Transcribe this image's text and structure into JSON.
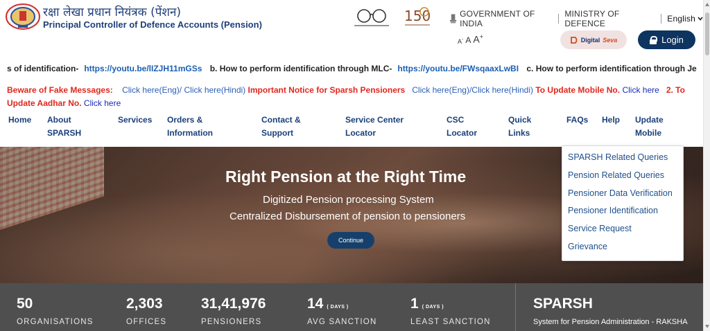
{
  "header": {
    "org_name_hi": "रक्षा लेखा प्रधान नियंत्रक (पेंशन)",
    "org_name_en": "Principal Controller of Defence Accounts (Pension)",
    "government": "GOVERNMENT OF INDIA",
    "ministry": "MINISTRY OF DEFENCE",
    "language": "English",
    "font_small": "A",
    "font_medium": "A",
    "font_large": "A",
    "font_large_suffix": "+",
    "digiseva_prefix": "Digital",
    "digiseva_suffix": "Seva",
    "login_label": "Login"
  },
  "marquee": {
    "item1_text": "s of identification-",
    "item1_link": "https://youtu.be/lIZJH11mGSs",
    "item2_text": "b. How to perform identification through MLC-",
    "item2_link": "https://youtu.be/FWsqaaxLwBI",
    "item3_text": "c. How to perform identification through Je"
  },
  "notice": {
    "fake_label": "Beware of Fake Messages:",
    "fake_eng": "Click here(Eng)",
    "slash1": "/",
    "fake_hindi": "Click here(Hindi)",
    "sparsh_label": "Important Notice for Sparsh Pensioners",
    "sparsh_eng": "Click here(Eng)",
    "slash2": "/",
    "sparsh_hindi": "Click here(Hindi)",
    "mobile_label": "To Update Mobile No.",
    "mobile_link": "Click here",
    "aadhar_label": "2. To Update Aadhar No.",
    "aadhar_link": "Click here"
  },
  "nav": {
    "home": "Home",
    "about": "About SPARSH",
    "services": "Services",
    "orders": "Orders & Information",
    "contact": "Contact & Support",
    "service_center": "Service Center Locator",
    "csc": "CSC Locator",
    "quick_links": "Quick Links",
    "faqs": "FAQs",
    "help": "Help",
    "update_mobile": "Update Mobile"
  },
  "faq_dropdown": [
    "SPARSH Related Queries",
    "Pension Related Queries",
    "Pensioner Data Verification",
    "Pensioner Identification",
    "Service Request",
    "Grievance"
  ],
  "hero": {
    "title": "Right Pension at the Right Time",
    "subtitle1": "Digitized Pension processing System",
    "subtitle2": "Centralized Disbursement of pension to pensioners",
    "cta": "Continue"
  },
  "stats": [
    {
      "value": "50",
      "unit": "",
      "label": "ORGANISATIONS"
    },
    {
      "value": "2,303",
      "unit": "",
      "label": "OFFICES"
    },
    {
      "value": "31,41,976",
      "unit": "",
      "label": "PENSIONERS"
    },
    {
      "value": "14",
      "unit": "( DAYS )",
      "label": "AVG SANCTION"
    },
    {
      "value": "1",
      "unit": "( DAYS )",
      "label": "LEAST SANCTION"
    }
  ],
  "sparsh": {
    "title": "SPARSH",
    "subtitle": "System for Pension Administration - RAKSHA"
  },
  "colors": {
    "navy": "#0e3460",
    "link_blue": "#1a5fb4",
    "alert_red": "#e0271c",
    "stats_bg": "#4f4f4f"
  }
}
